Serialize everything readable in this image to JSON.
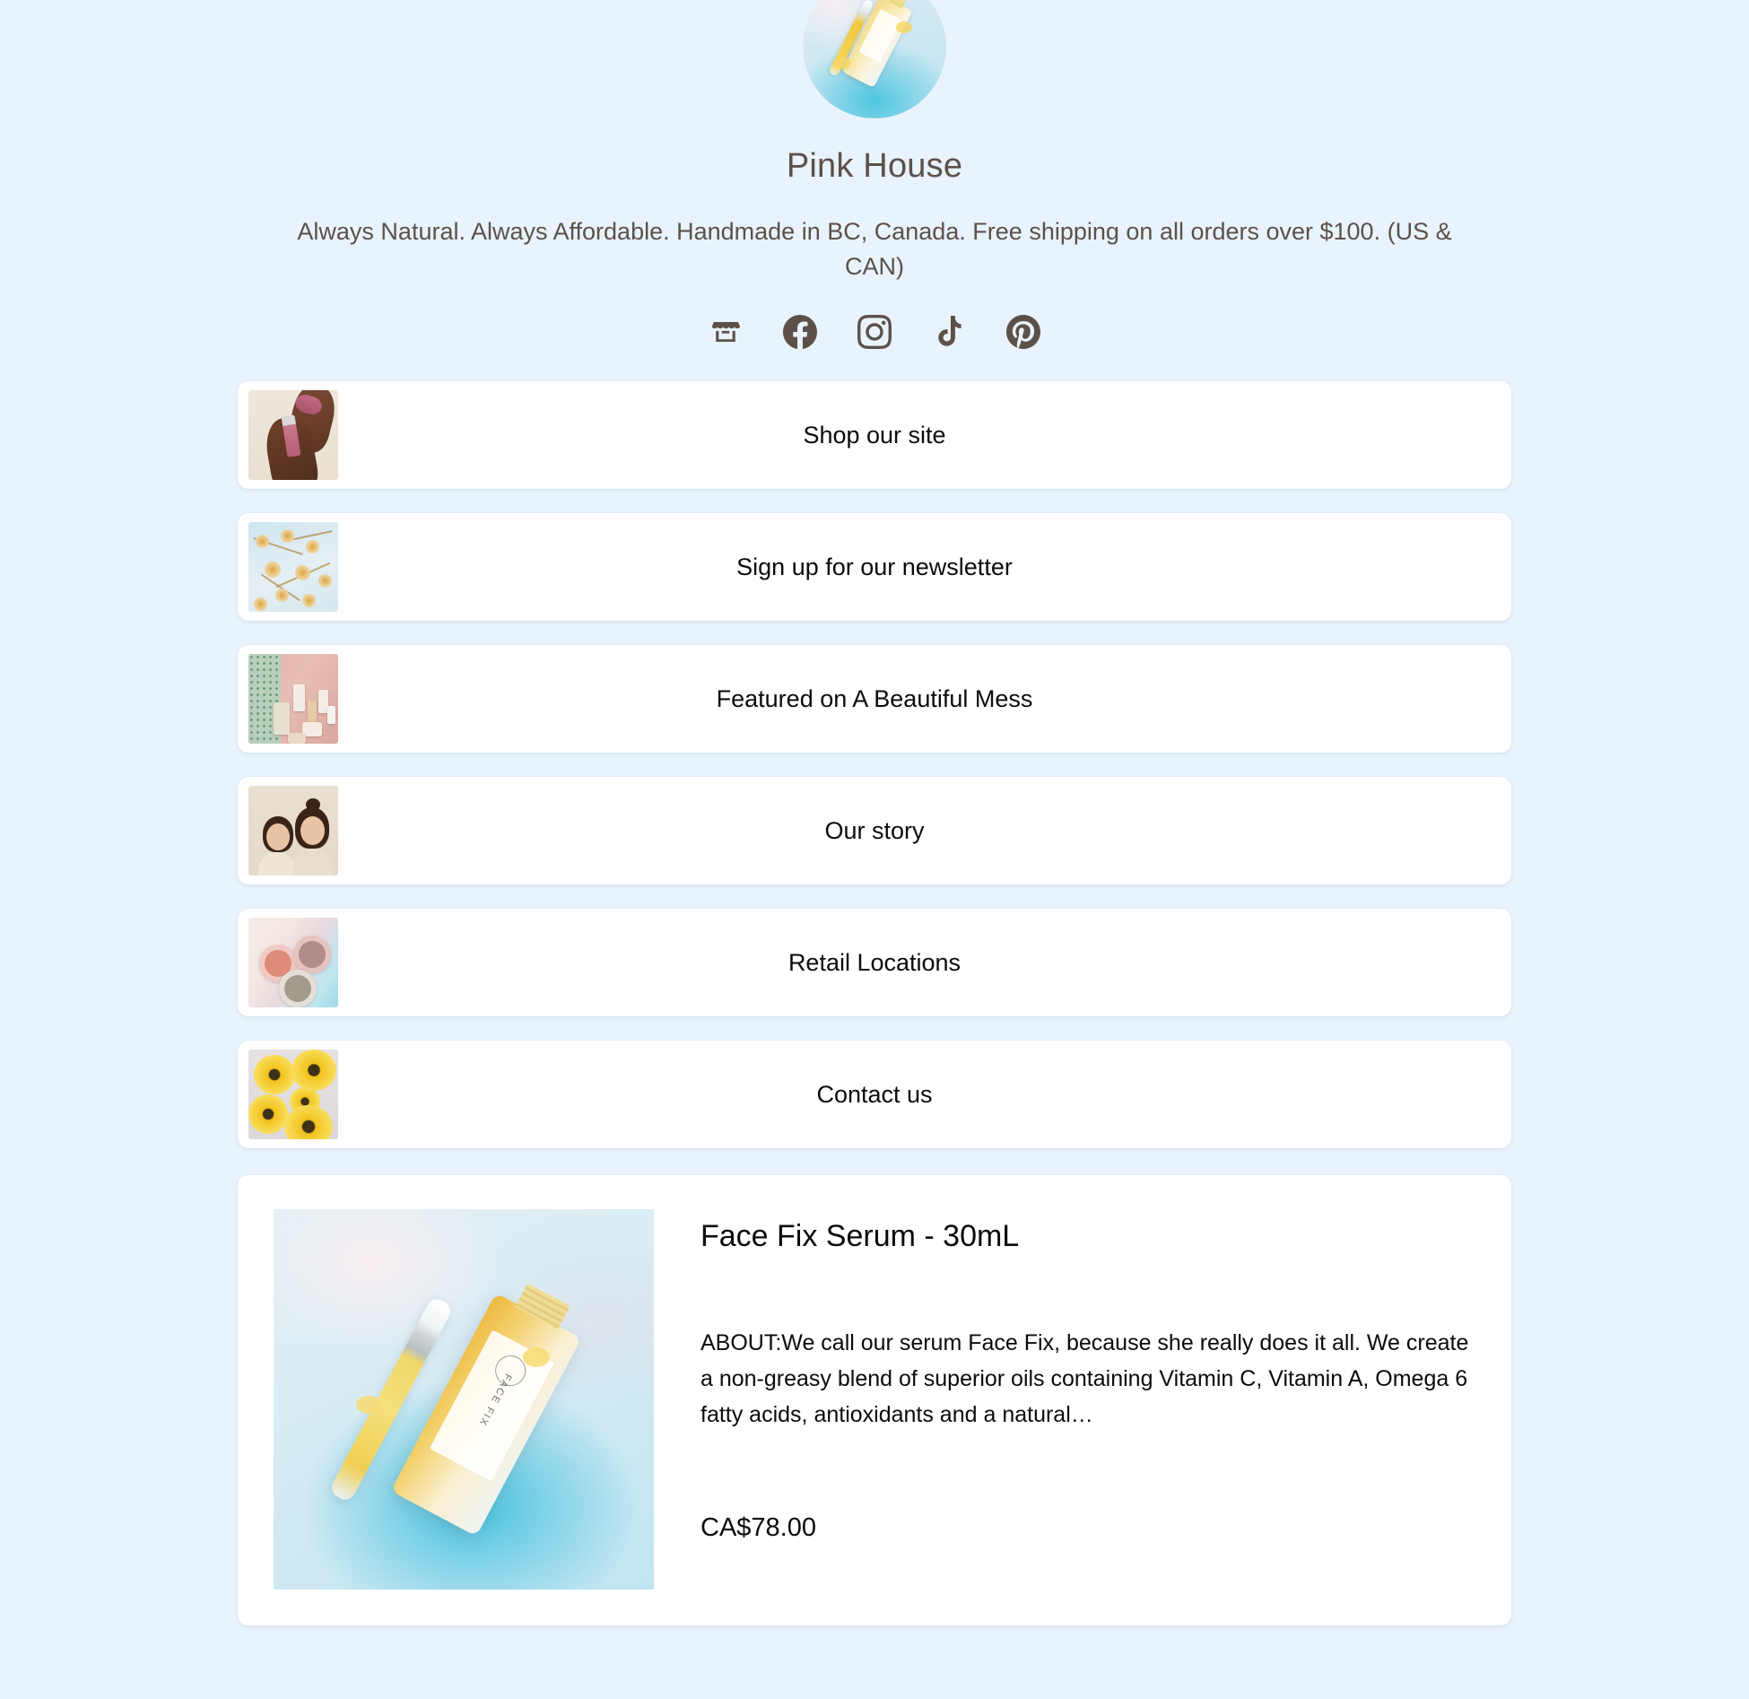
{
  "profile": {
    "name": "Pink House",
    "tagline": "Always Natural. Always Affordable. Handmade in BC, Canada. Free shipping on all orders over $100. (US & CAN)",
    "avatar_alt": "serum-bottle-avatar",
    "colors": {
      "background": "#e9f3fd",
      "card": "#ffffff",
      "heading_text": "#5c5149",
      "body_text": "#0b0b0b",
      "icon": "#5c5149"
    }
  },
  "socials": [
    {
      "name": "storefront-icon",
      "label": "Shop"
    },
    {
      "name": "facebook-icon",
      "label": "Facebook"
    },
    {
      "name": "instagram-icon",
      "label": "Instagram"
    },
    {
      "name": "tiktok-icon",
      "label": "TikTok"
    },
    {
      "name": "pinterest-icon",
      "label": "Pinterest"
    }
  ],
  "links": [
    {
      "label": "Shop our site",
      "thumb": "hands-holding-pink-balm"
    },
    {
      "label": "Sign up for our newsletter",
      "thumb": "dried-chamomile-flowers"
    },
    {
      "label": "Featured on A Beautiful Mess",
      "thumb": "skincare-products-on-pink-fur"
    },
    {
      "label": "Our story",
      "thumb": "two-women-portrait"
    },
    {
      "label": "Retail Locations",
      "thumb": "three-balm-tins"
    },
    {
      "label": "Contact us",
      "thumb": "yellow-dried-flowers"
    }
  ],
  "product": {
    "title": "Face Fix Serum - 30mL",
    "description": "ABOUT:We call our serum Face Fix, because she really does it all. We create a non-greasy blend of superior oils containing Vitamin C, Vitamin A, Omega 6 fatty acids, antioxidants and a natural…",
    "price": "CA$78.00",
    "image_alt": "face-fix-serum-bottle-with-dropper",
    "bottle_label_text": "FACE FIX"
  }
}
